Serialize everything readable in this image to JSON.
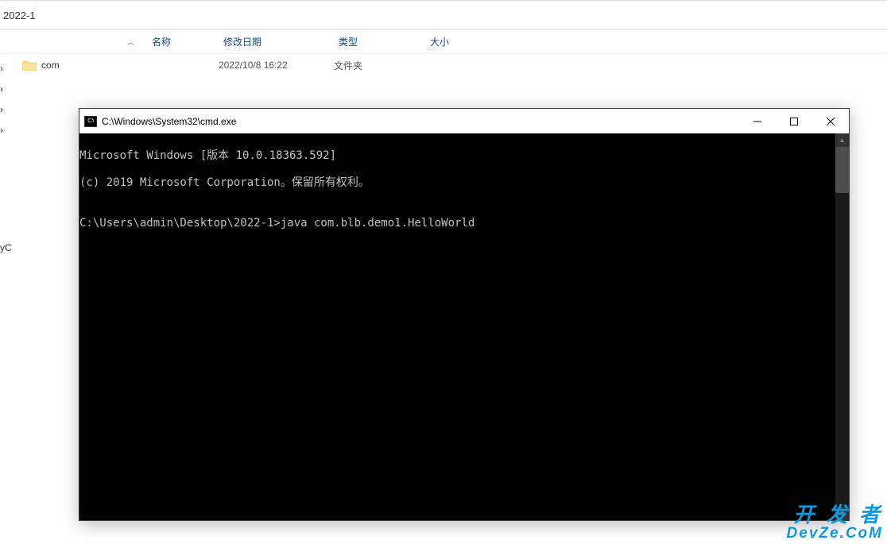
{
  "explorer": {
    "folder_name": "2022-1",
    "columns": {
      "name": "名称",
      "date": "修改日期",
      "type": "类型",
      "size": "大小"
    },
    "items": [
      {
        "name": "com",
        "date": "2022/10/8 16:22",
        "type": "文件夹",
        "size": ""
      }
    ],
    "left_fragment": "yC"
  },
  "cmd": {
    "title": "C:\\Windows\\System32\\cmd.exe",
    "lines": [
      "Microsoft Windows [版本 10.0.18363.592]",
      "(c) 2019 Microsoft Corporation。保留所有权利。",
      "",
      "C:\\Users\\admin\\Desktop\\2022-1>java com.blb.demo1.HelloWorld"
    ]
  },
  "watermark": {
    "line1": "开 发 者",
    "line2": "DevZe.CoM"
  }
}
